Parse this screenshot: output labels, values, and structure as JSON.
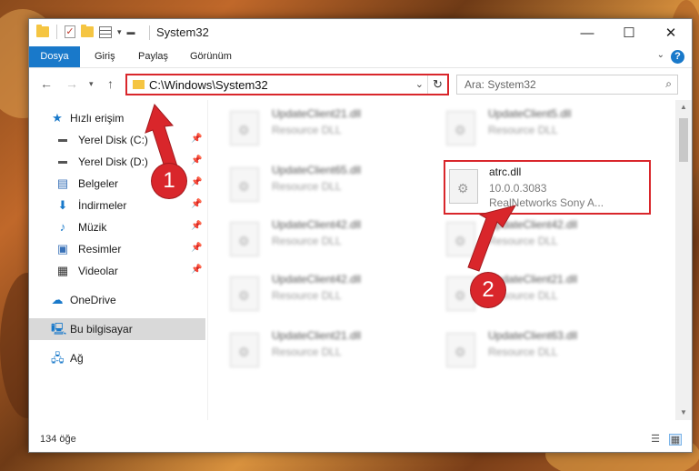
{
  "window": {
    "title": "System32",
    "controls": {
      "minimize": "—",
      "maximize": "☐",
      "close": "✕"
    }
  },
  "ribbon": {
    "tabs": [
      {
        "label": "Dosya"
      },
      {
        "label": "Giriş"
      },
      {
        "label": "Paylaş"
      },
      {
        "label": "Görünüm"
      }
    ],
    "help": "?"
  },
  "navigation": {
    "address": "C:\\Windows\\System32",
    "search_placeholder": "Ara: System32"
  },
  "sidebar": {
    "quick_access": "Hızlı erişim",
    "items": [
      {
        "label": "Yerel Disk (C:)",
        "icon": "drive-icon"
      },
      {
        "label": "Yerel Disk (D:)",
        "icon": "drive-icon"
      },
      {
        "label": "Belgeler",
        "icon": "documents-icon"
      },
      {
        "label": "İndirmeler",
        "icon": "download-icon"
      },
      {
        "label": "Müzik",
        "icon": "music-icon"
      },
      {
        "label": "Resimler",
        "icon": "pictures-icon"
      },
      {
        "label": "Videolar",
        "icon": "video-icon"
      }
    ],
    "onedrive": "OneDrive",
    "this_pc": "Bu bilgisayar",
    "network": "Ağ"
  },
  "files": [
    {
      "name": "UpdateClient21.dll",
      "type": "Resource DLL"
    },
    {
      "name": "UpdateClient5.dll",
      "type": "Resource DLL"
    },
    {
      "name": "UpdateClient65.dll",
      "type": "Resource DLL"
    },
    {
      "name": "atrc.dll",
      "version": "10.0.0.3083",
      "company": "RealNetworks Sony A..."
    },
    {
      "name": "UpdateClient42.dll",
      "type": "Resource DLL"
    },
    {
      "name": "UpdateClient42.dll",
      "type": "Resource DLL"
    },
    {
      "name": "UpdateClient42.dll",
      "type": "Resource DLL"
    },
    {
      "name": "UpdateClient21.dll",
      "type": "Resource DLL"
    },
    {
      "name": "UpdateClient21.dll",
      "type": "Resource DLL"
    },
    {
      "name": "UpdateClient63.dll",
      "type": "Resource DLL"
    }
  ],
  "status": {
    "item_count": "134 öğe"
  },
  "callouts": {
    "first": "1",
    "second": "2"
  },
  "colors": {
    "accent": "#1979ca",
    "highlight": "#d9262b"
  }
}
